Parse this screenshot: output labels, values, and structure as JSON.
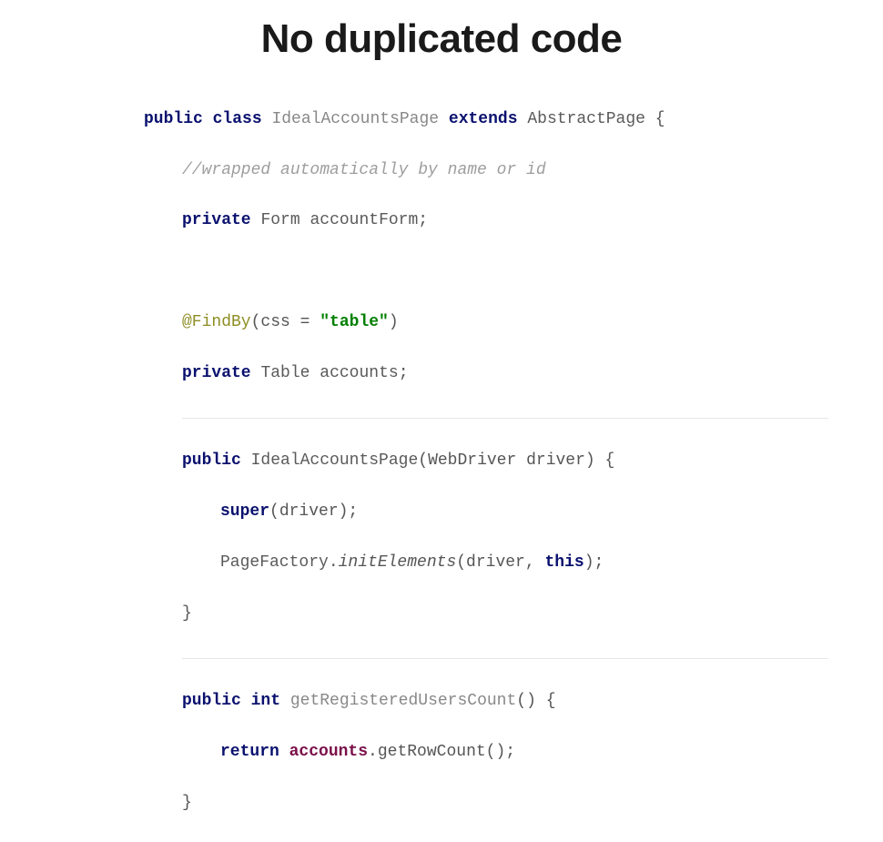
{
  "title": "No duplicated code",
  "code": {
    "l1": {
      "kw1": "public",
      "kw2": "class",
      "classname": "IdealAccountsPage",
      "kw3": "extends",
      "superclass": "AbstractPage",
      "brace": " {"
    },
    "l2": {
      "comment": "//wrapped automatically by name or id"
    },
    "l3": {
      "kw": "private",
      "type": "Form",
      "name": "accountForm",
      "semi": ";"
    },
    "l4": {
      "anno": "@FindBy",
      "open": "(css = ",
      "str": "\"table\"",
      "close": ")"
    },
    "l5": {
      "kw": "private",
      "type": "Table",
      "name": "accounts",
      "semi": ";"
    },
    "l6": {
      "kw": "public",
      "ctor": "IdealAccountsPage",
      "params": "(WebDriver driver) {"
    },
    "l7": {
      "kw": "super",
      "rest": "(driver);"
    },
    "l8": {
      "cls": "PageFactory.",
      "method": "initElements",
      "open": "(driver, ",
      "kw": "this",
      "close": ");"
    },
    "l9": {
      "brace": "}"
    },
    "l10": {
      "kw1": "public",
      "kw2": "int",
      "name": "getRegisteredUsersCount",
      "params": "() {"
    },
    "l11": {
      "kw": "return",
      "field": "accounts",
      "rest": ".getRowCount();"
    },
    "l12": {
      "brace": "}"
    }
  }
}
